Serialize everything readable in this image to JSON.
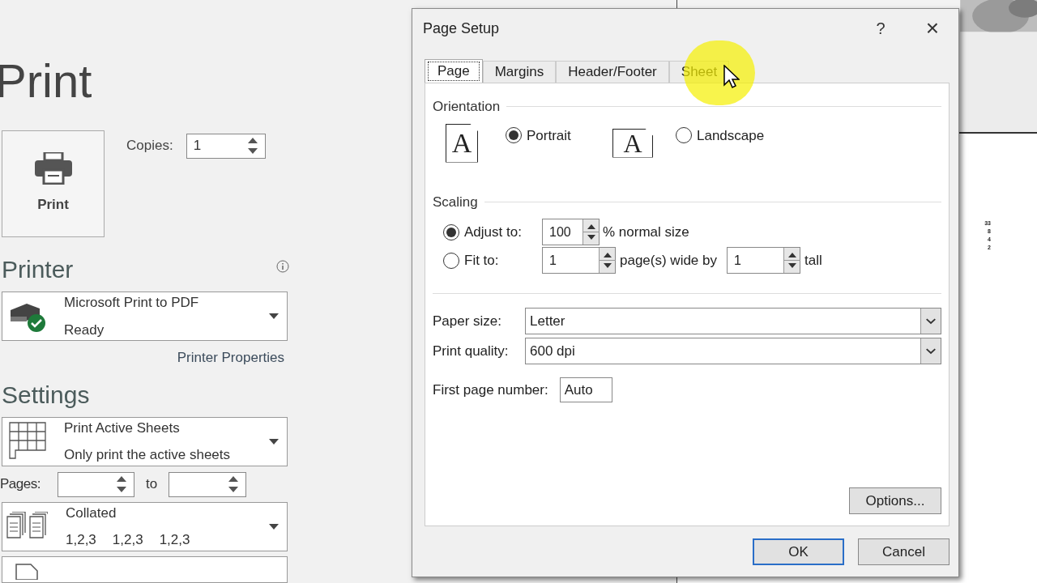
{
  "backstage": {
    "title": "Print",
    "print_button": "Print",
    "copies": {
      "label": "Copies:",
      "value": "1"
    },
    "printer": {
      "heading": "Printer",
      "name": "Microsoft Print to PDF",
      "status": "Ready",
      "properties_link": "Printer Properties"
    },
    "settings": {
      "heading": "Settings",
      "what": {
        "title": "Print Active Sheets",
        "subtitle": "Only print the active sheets"
      },
      "pages": {
        "label": "Pages:",
        "to": "to"
      },
      "collation": {
        "title": "Collated",
        "sets": [
          "1,2,3",
          "1,2,3",
          "1,2,3"
        ]
      }
    }
  },
  "preview": {
    "numbers": [
      "33",
      "8",
      "4",
      "2"
    ]
  },
  "dialog": {
    "title": "Page Setup",
    "help": "?",
    "close": "×",
    "tabs": [
      {
        "label": "Page",
        "selected": true
      },
      {
        "label": "Margins",
        "selected": false
      },
      {
        "label": "Header/Footer",
        "selected": false
      },
      {
        "label": "Sheet",
        "selected": false
      }
    ],
    "orientation": {
      "label": "Orientation",
      "options": [
        {
          "label": "Portrait",
          "icon_letter": "A",
          "selected": true
        },
        {
          "label": "Landscape",
          "icon_letter": "A",
          "selected": false
        }
      ]
    },
    "scaling": {
      "label": "Scaling",
      "adjust": {
        "label": "Adjust to:",
        "selected": true,
        "value": "100",
        "suffix": "% normal size"
      },
      "fit": {
        "label": "Fit to:",
        "selected": false,
        "wide": "1",
        "wide_suffix": "page(s) wide by",
        "tall": "1",
        "tall_suffix": "tall"
      }
    },
    "paper_size": {
      "label": "Paper size:",
      "value": "Letter"
    },
    "print_quality": {
      "label": "Print quality:",
      "value": "600 dpi"
    },
    "first_page_number": {
      "label": "First page number:",
      "value": "Auto"
    },
    "options_button": "Options...",
    "buttons": [
      "OK",
      "Cancel"
    ]
  }
}
